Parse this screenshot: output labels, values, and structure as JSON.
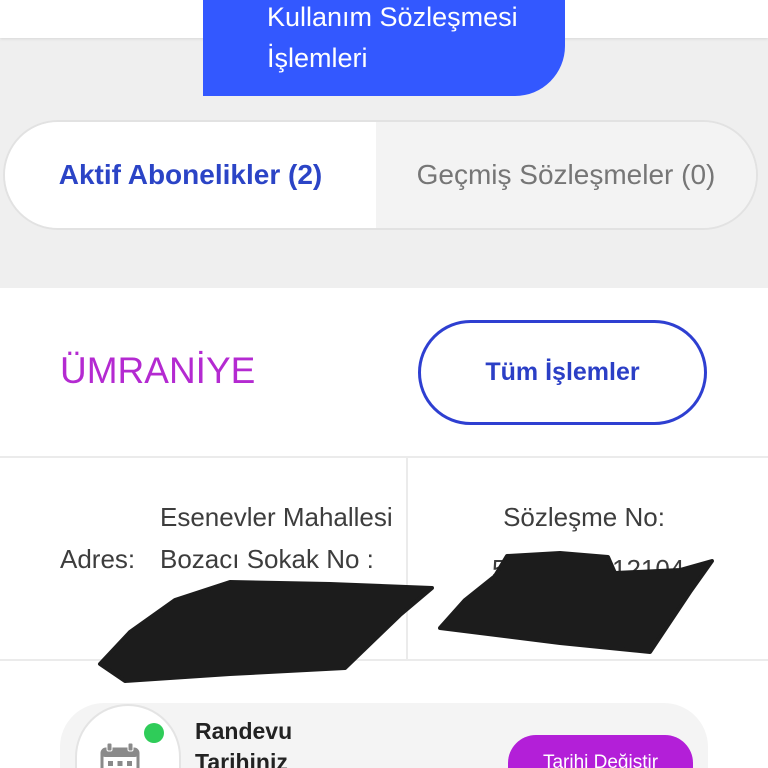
{
  "header": {
    "title_lines": [
      "Kullanım Sözleşmesi",
      "İşlemleri"
    ]
  },
  "tabs": [
    {
      "label": "Aktif Abonelikler (2)",
      "active": true
    },
    {
      "label": "Geçmiş Sözleşmeler (0)",
      "active": false
    }
  ],
  "subscription": {
    "district": "ÜMRANİYE",
    "all_actions_button": "Tüm İşlemler",
    "address_label": "Adres:",
    "address_lines": [
      "Esenevler Mahallesi",
      "Bozacı Sokak No :"
    ],
    "contract_label": "Sözleşme No:",
    "contract_number_visible": [
      "5",
      "12104"
    ],
    "appointment": {
      "label": "Randevu Tarihiniz",
      "icon": "calendar-icon",
      "change_date_button": "Tarihi Değiştir"
    }
  },
  "colors": {
    "page_background": "#efefef",
    "title_banner": "#3358ff",
    "active_tab_text": "#2b44c6",
    "inactive_tab_text": "#767676",
    "district_text": "#b42ad1",
    "outline_button": "#2e3fd1",
    "change_date_button": "#b31fd8",
    "status_dot": "#2fcc59"
  }
}
